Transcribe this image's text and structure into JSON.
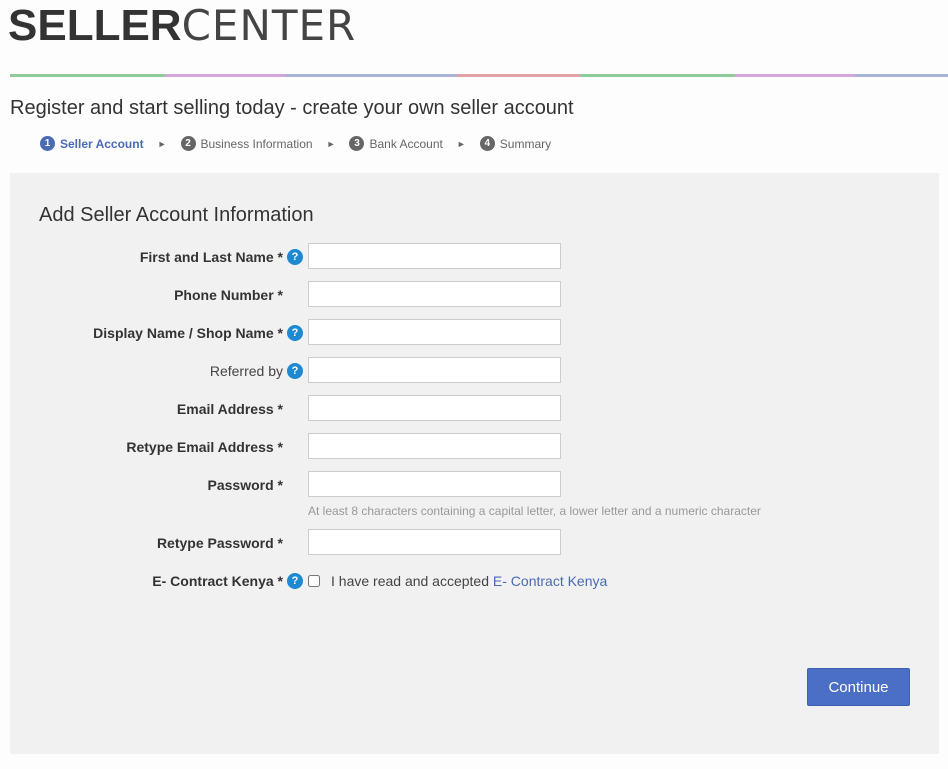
{
  "brand": {
    "bold": "SELLER",
    "thin": "CENTER"
  },
  "color_bar": [
    "#8fcb9b",
    "#d5a6d9",
    "#a7b4d6",
    "#e2a3a6",
    "#8fcb9b",
    "#d5a6d9",
    "#a7b4d6"
  ],
  "page_title": "Register and start selling today - create your own seller account",
  "steps": [
    {
      "num": "1",
      "label": "Seller Account",
      "active": true
    },
    {
      "num": "2",
      "label": "Business Information",
      "active": false
    },
    {
      "num": "3",
      "label": "Bank Account",
      "active": false
    },
    {
      "num": "4",
      "label": "Summary",
      "active": false
    }
  ],
  "step_arrow": "►",
  "form": {
    "title": "Add Seller Account Information",
    "fields": [
      {
        "label": "First and Last Name *",
        "help": true,
        "value": ""
      },
      {
        "label": "Phone Number *",
        "help": false,
        "value": ""
      },
      {
        "label": "Display Name / Shop Name *",
        "help": true,
        "value": ""
      },
      {
        "label": "Referred by",
        "help": true,
        "value": ""
      },
      {
        "label": "Email Address *",
        "help": false,
        "value": ""
      },
      {
        "label": "Retype Email Address *",
        "help": false,
        "value": ""
      },
      {
        "label": "Password *",
        "help": false,
        "value": ""
      },
      {
        "label": "Retype Password *",
        "help": false,
        "value": ""
      }
    ],
    "password_hint": "At least 8 characters containing a capital letter, a lower letter and a numeric character",
    "contract": {
      "label": "E- Contract Kenya *",
      "checked": false,
      "text": "I have read and accepted ",
      "link": "E- Contract Kenya"
    },
    "help_glyph": "?",
    "continue_label": "Continue"
  }
}
